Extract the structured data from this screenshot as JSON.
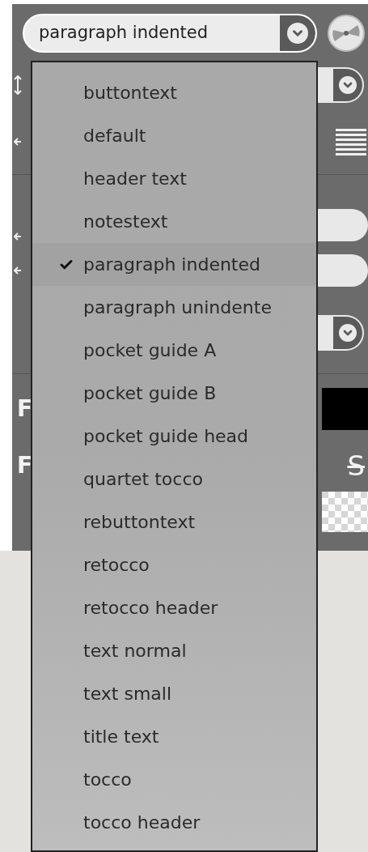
{
  "style_select": {
    "value": "paragraph indented",
    "expanded": true
  },
  "style_menu": [
    {
      "label": "buttontext",
      "selected": false
    },
    {
      "label": "default",
      "selected": false
    },
    {
      "label": "header text",
      "selected": false
    },
    {
      "label": "notestext",
      "selected": false
    },
    {
      "label": "paragraph indented",
      "selected": true
    },
    {
      "label": "paragraph unindente",
      "selected": false
    },
    {
      "label": "pocket guide A",
      "selected": false
    },
    {
      "label": "pocket guide B",
      "selected": false
    },
    {
      "label": "pocket guide head",
      "selected": false
    },
    {
      "label": "quartet tocco",
      "selected": false
    },
    {
      "label": "rebuttontext",
      "selected": false
    },
    {
      "label": "retocco",
      "selected": false
    },
    {
      "label": "retocco header",
      "selected": false
    },
    {
      "label": "text normal",
      "selected": false
    },
    {
      "label": "text small",
      "selected": false
    },
    {
      "label": "title text",
      "selected": false
    },
    {
      "label": "tocco",
      "selected": false
    },
    {
      "label": "tocco header",
      "selected": false
    }
  ],
  "font_rows": [
    {
      "glyph": "F"
    },
    {
      "glyph": "F"
    }
  ],
  "strike_button": {
    "label": "S"
  }
}
